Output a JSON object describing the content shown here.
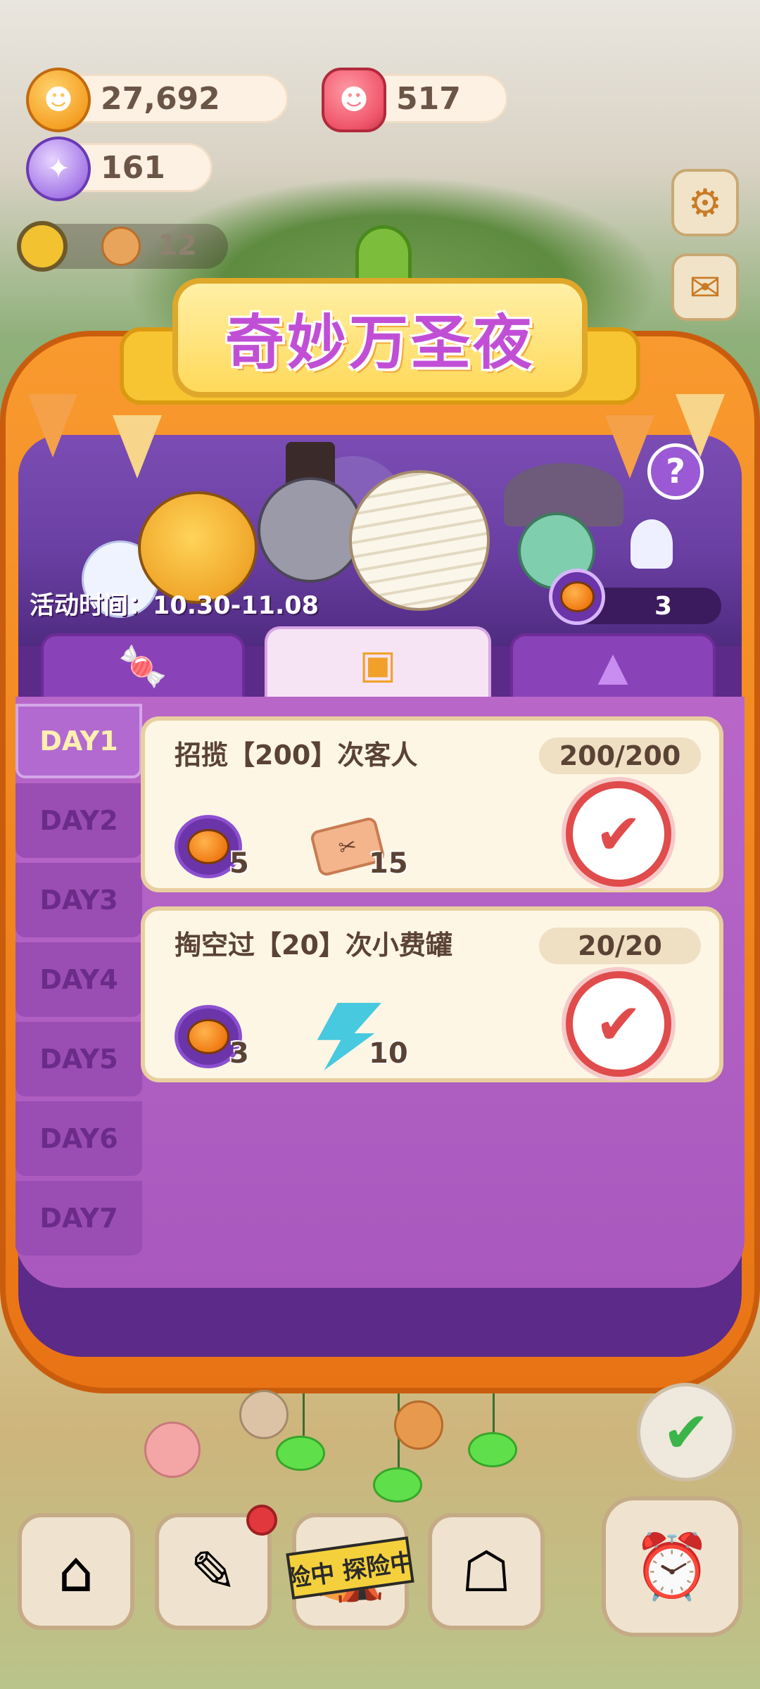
{
  "currencies": {
    "cookies": "27,692",
    "candles": "517",
    "candy": "161"
  },
  "energy": {
    "count": "12"
  },
  "event": {
    "title": "奇妙万圣夜",
    "time": "活动时间：10.30-11.08",
    "pumpkin_tokens": "3",
    "help_symbol": "?"
  },
  "tabs": [
    {
      "icon": "candy-icon"
    },
    {
      "icon": "task-card-icon"
    },
    {
      "icon": "witch-hat-icon"
    }
  ],
  "days": [
    "DAY1",
    "DAY2",
    "DAY3",
    "DAY4",
    "DAY5",
    "DAY6",
    "DAY7"
  ],
  "tasks": [
    {
      "title": "招揽【200】次客人",
      "progress": "200/200",
      "rewards": [
        {
          "type": "pumpkin-token",
          "qty": "5"
        },
        {
          "type": "ticket",
          "qty": "15"
        }
      ],
      "status": "completed"
    },
    {
      "title": "掏空过【20】次小费罐",
      "progress": "20/20",
      "rewards": [
        {
          "type": "pumpkin-token",
          "qty": "3"
        },
        {
          "type": "energy-bolt",
          "qty": "10"
        }
      ],
      "status": "completed"
    }
  ],
  "bottom": {
    "tape_text": "险中 探险中"
  },
  "colors": {
    "frame_orange": "#f2861e",
    "panel_purple": "#a958bd",
    "banner_yellow": "#ffd95a",
    "stamp_red": "#e04b4b"
  }
}
